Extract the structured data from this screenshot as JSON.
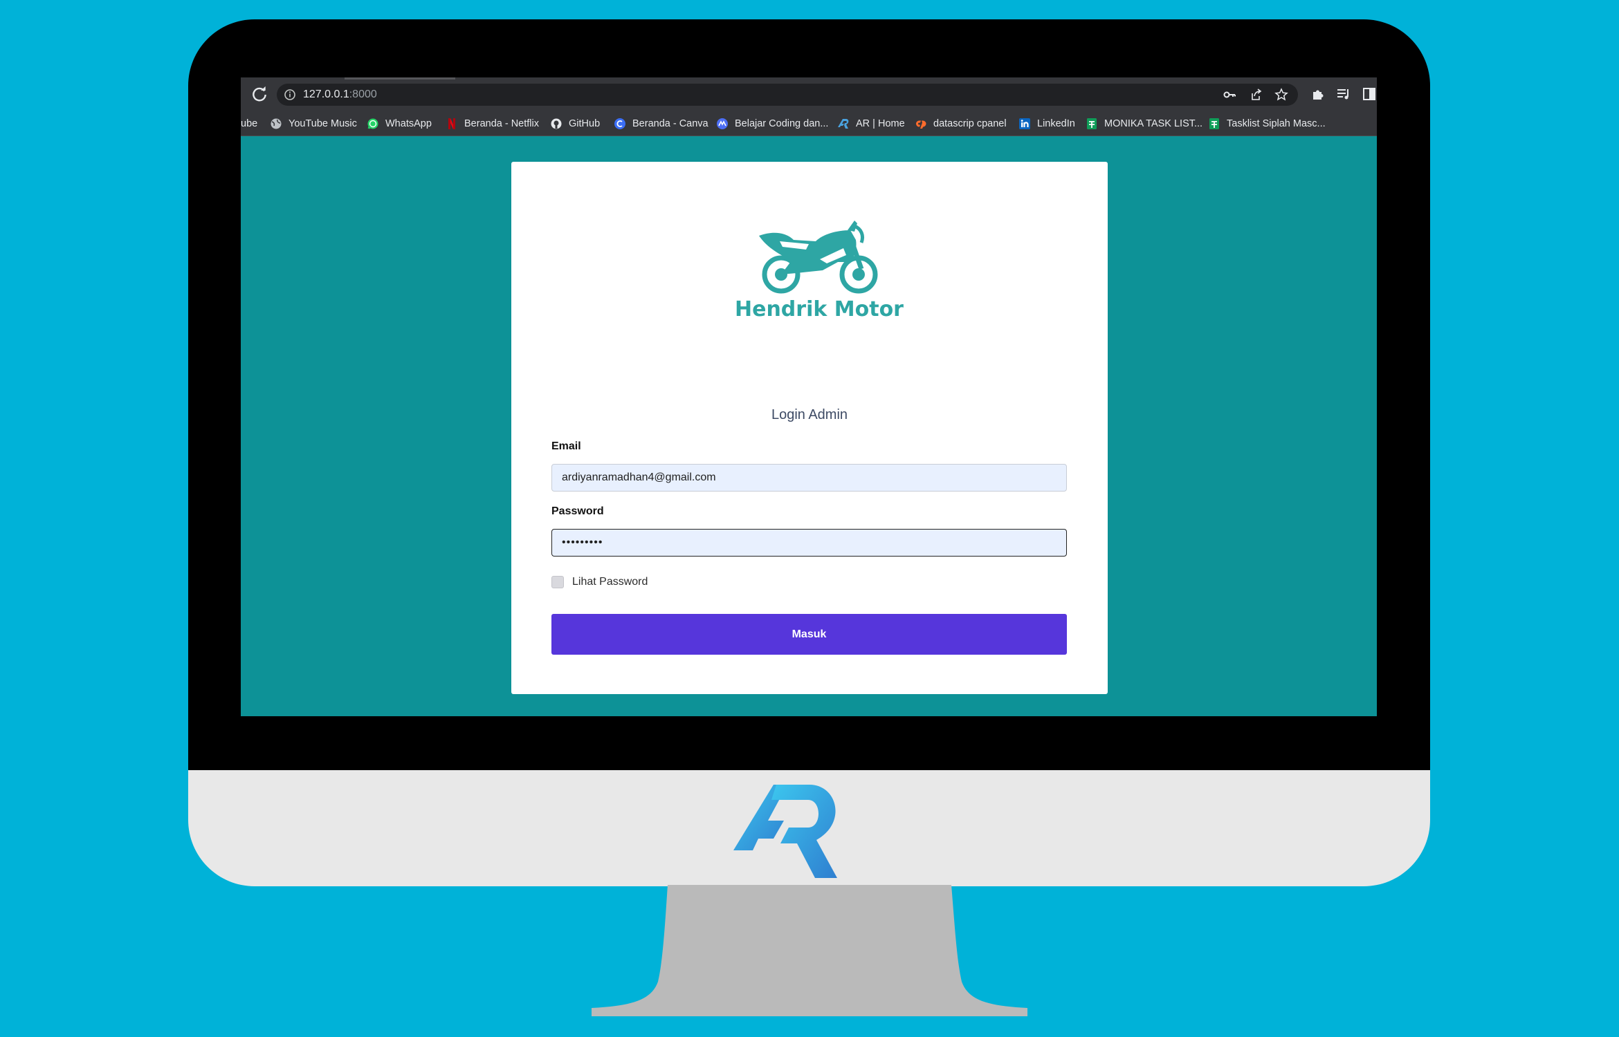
{
  "browser": {
    "url_host": "127.0.0.1",
    "url_port": ":8000",
    "bookmarks": [
      {
        "label": "ube",
        "icon": "youtube-icon"
      },
      {
        "label": "YouTube Music",
        "icon": "globe-icon"
      },
      {
        "label": "WhatsApp",
        "icon": "whatsapp-icon"
      },
      {
        "label": "Beranda - Netflix",
        "icon": "netflix-icon"
      },
      {
        "label": "GitHub",
        "icon": "github-icon"
      },
      {
        "label": "Beranda - Canva",
        "icon": "canva-icon"
      },
      {
        "label": "Belajar Coding dan...",
        "icon": "meta-icon"
      },
      {
        "label": "AR | Home",
        "icon": "ar-icon"
      },
      {
        "label": "datascrip cpanel",
        "icon": "cpanel-icon"
      },
      {
        "label": "LinkedIn",
        "icon": "linkedin-icon"
      },
      {
        "label": "MONIKA TASK LIST...",
        "icon": "sheets-icon"
      },
      {
        "label": "Tasklist Siplah Masc...",
        "icon": "sheets-icon"
      }
    ]
  },
  "logo": {
    "brand": "Hendrik Motor"
  },
  "login": {
    "title": "Login Admin",
    "email_label": "Email",
    "email_value": "ardiyanramadhan4@gmail.com",
    "password_label": "Password",
    "password_value": "•••••••••",
    "show_password_label": "Lihat Password",
    "submit_label": "Masuk"
  },
  "colors": {
    "page_background": "#00b2d8",
    "screen_background": "#0d9297",
    "brand_teal": "#2ea6a4",
    "button": "#5636db"
  }
}
